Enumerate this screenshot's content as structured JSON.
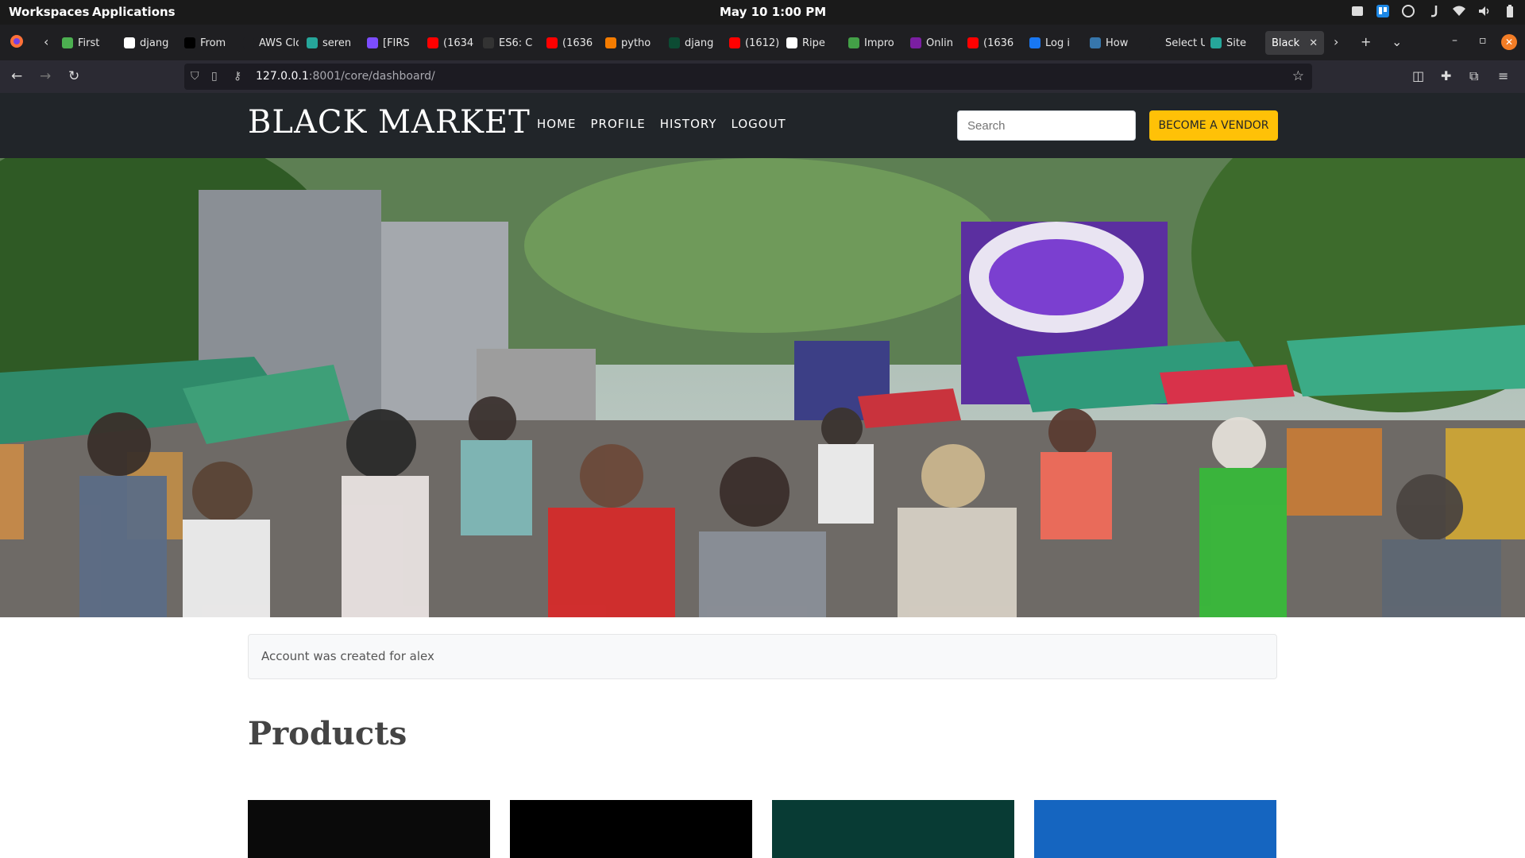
{
  "os": {
    "workspaces": "Workspaces",
    "applications": "Applications",
    "clock": "May 10   1:00 PM"
  },
  "browser": {
    "tabs": [
      {
        "label": "First",
        "color": "#4caf50"
      },
      {
        "label": "djang",
        "color": "#ffffff"
      },
      {
        "label": "From",
        "color": "#000000"
      },
      {
        "label": "AWS Clou",
        "color": "#1f1f22"
      },
      {
        "label": "seren",
        "color": "#26a69a"
      },
      {
        "label": "[FIRS",
        "color": "#7c4dff"
      },
      {
        "label": "(1634",
        "color": "#ff0000"
      },
      {
        "label": "ES6: C",
        "color": "#333333"
      },
      {
        "label": "(1636",
        "color": "#ff0000"
      },
      {
        "label": "pytho",
        "color": "#f57c00"
      },
      {
        "label": "djang",
        "color": "#0c4b33"
      },
      {
        "label": "(1612)",
        "color": "#ff0000"
      },
      {
        "label": "Ripe",
        "color": "#ffffff"
      },
      {
        "label": "Impro",
        "color": "#43a047"
      },
      {
        "label": "Onlin",
        "color": "#7b1fa2"
      },
      {
        "label": "(1636",
        "color": "#ff0000"
      },
      {
        "label": "Log i",
        "color": "#1877f2"
      },
      {
        "label": "How",
        "color": "#3776ab"
      },
      {
        "label": "Select Us",
        "color": "#1f1f22"
      },
      {
        "label": "Site",
        "color": "#26a69a"
      }
    ],
    "active_tab": "Black",
    "url_host": "127.0.0.1",
    "url_rest": ":8001/core/dashboard/"
  },
  "site": {
    "brand": "BLACK MARKET",
    "menu": [
      "HOME",
      "PROFILE",
      "HISTORY",
      "LOGOUT"
    ],
    "search_placeholder": "Search",
    "vendor_button": "BECOME A VENDOR",
    "alert": "Account was created for alex",
    "products_title": "Products",
    "card_colors": [
      "#0a0a0a",
      "#000000",
      "#083b34",
      "#1565c0"
    ]
  }
}
